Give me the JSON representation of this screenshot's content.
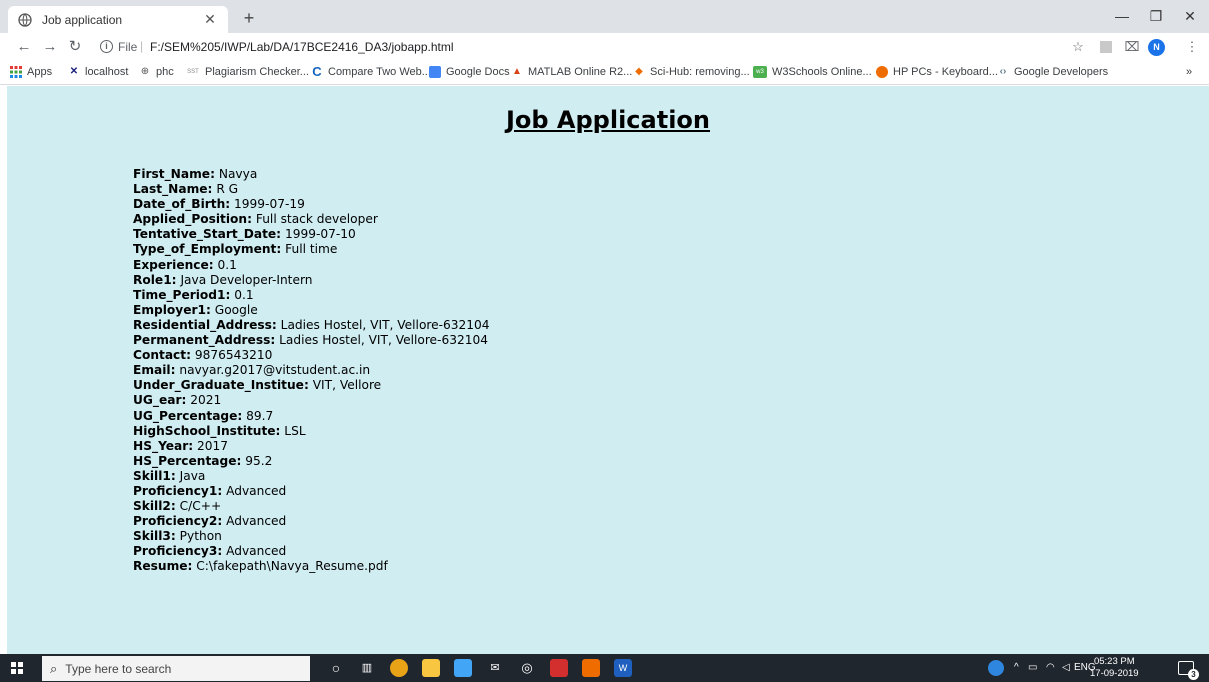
{
  "browser": {
    "tab": {
      "title": "Job application"
    },
    "address": {
      "scheme": "File",
      "path": "F:/SEM%205/IWP/Lab/DA/17BCE2416_DA3/jobapp.html"
    },
    "bookmarks": [
      {
        "label": "Apps",
        "icon": "apps-grid-icon",
        "color": "#e53935"
      },
      {
        "label": "localhost",
        "icon": "tools-icon",
        "color": "#1a237e"
      },
      {
        "label": "phc",
        "icon": "globe-icon",
        "color": "#555555"
      },
      {
        "label": "Plagiarism Checker...",
        "icon": "sst-icon",
        "color": "#888888"
      },
      {
        "label": "Compare Two Web...",
        "icon": "c-logo-icon",
        "color": "#1565c0"
      },
      {
        "label": "Google Docs",
        "icon": "docs-icon",
        "color": "#4285f4"
      },
      {
        "label": "MATLAB Online R2...",
        "icon": "matlab-icon",
        "color": "#d84315"
      },
      {
        "label": "Sci-Hub: removing...",
        "icon": "scihub-icon",
        "color": "#ef6c00"
      },
      {
        "label": "W3Schools Online...",
        "icon": "w3schools-icon",
        "color": "#4caf50"
      },
      {
        "label": "HP PCs - Keyboard...",
        "icon": "hp-icon",
        "color": "#ef6c00"
      },
      {
        "label": "Google Developers",
        "icon": "google-dev-icon",
        "color": "#607d8b"
      }
    ],
    "more_bookmarks": "»"
  },
  "page": {
    "heading": "Job Application",
    "fields": [
      {
        "label": "First_Name:",
        "value": "Navya"
      },
      {
        "label": "Last_Name:",
        "value": "R G"
      },
      {
        "label": "Date_of_Birth:",
        "value": "1999-07-19"
      },
      {
        "label": "Applied_Position:",
        "value": "Full stack developer"
      },
      {
        "label": "Tentative_Start_Date:",
        "value": "1999-07-10"
      },
      {
        "label": "Type_of_Employment:",
        "value": "Full time"
      },
      {
        "label": "Experience:",
        "value": "0.1"
      },
      {
        "label": "Role1:",
        "value": "Java Developer-Intern"
      },
      {
        "label": "Time_Period1:",
        "value": "0.1"
      },
      {
        "label": "Employer1:",
        "value": "Google"
      },
      {
        "label": "Residential_Address:",
        "value": "Ladies Hostel, VIT, Vellore-632104"
      },
      {
        "label": "Permanent_Address:",
        "value": "Ladies Hostel, VIT, Vellore-632104"
      },
      {
        "label": "Contact:",
        "value": "9876543210"
      },
      {
        "label": "Email:",
        "value": "navyar.g2017@vitstudent.ac.in"
      },
      {
        "label": "Under_Graduate_Institue:",
        "value": "VIT, Vellore"
      },
      {
        "label": "UG_ear:",
        "value": "2021"
      },
      {
        "label": "UG_Percentage:",
        "value": "89.7"
      },
      {
        "label": "HighSchool_Institute:",
        "value": "LSL"
      },
      {
        "label": "HS_Year:",
        "value": "2017"
      },
      {
        "label": "HS_Percentage:",
        "value": "95.2"
      },
      {
        "label": "Skill1:",
        "value": "Java"
      },
      {
        "label": "Proficiency1:",
        "value": "Advanced"
      },
      {
        "label": "Skill2:",
        "value": "C/C++"
      },
      {
        "label": "Proficiency2:",
        "value": "Advanced"
      },
      {
        "label": "Skill3:",
        "value": "Python"
      },
      {
        "label": "Proficiency3:",
        "value": "Advanced"
      },
      {
        "label": "Resume:",
        "value": "C:\\fakepath\\Navya_Resume.pdf"
      }
    ]
  },
  "taskbar": {
    "search_placeholder": "Type here to search",
    "language": "ENG",
    "time": "05:23 PM",
    "date": "17-09-2019",
    "notification_count": "3"
  },
  "colors": {
    "page_background": "#d0edf2",
    "tab_strip": "#dee1e6",
    "taskbar": "#20262e"
  }
}
